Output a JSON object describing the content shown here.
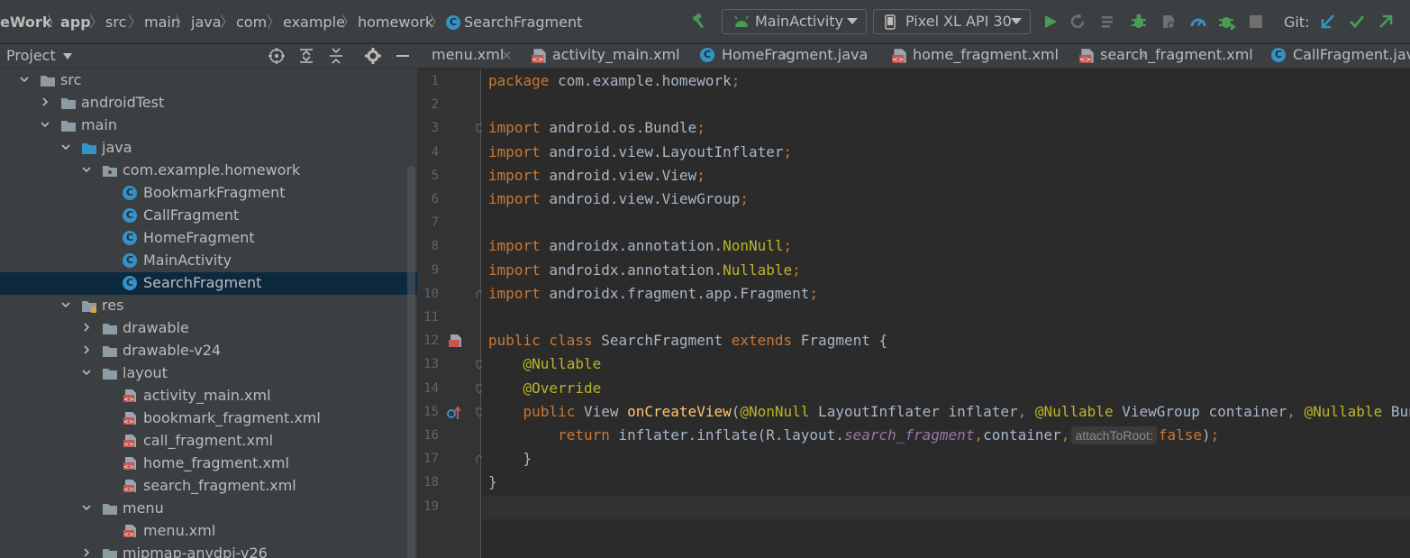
{
  "breadcrumb": [
    "eWork",
    "app",
    "src",
    "main",
    "java",
    "com",
    "example",
    "homework",
    "SearchFragment"
  ],
  "toolbar": {
    "run_config": "MainActivity",
    "device": "Pixel XL API 30",
    "git_label": "Git:"
  },
  "project_panel": {
    "title": "Project",
    "tree": [
      {
        "label": "src",
        "depth": 1,
        "kind": "folder",
        "expanded": true
      },
      {
        "label": "androidTest",
        "depth": 2,
        "kind": "folder",
        "expanded": false
      },
      {
        "label": "main",
        "depth": 2,
        "kind": "folder",
        "expanded": true
      },
      {
        "label": "java",
        "depth": 3,
        "kind": "src-folder",
        "expanded": true
      },
      {
        "label": "com.example.homework",
        "depth": 4,
        "kind": "package",
        "expanded": true
      },
      {
        "label": "BookmarkFragment",
        "depth": 5,
        "kind": "class"
      },
      {
        "label": "CallFragment",
        "depth": 5,
        "kind": "class"
      },
      {
        "label": "HomeFragment",
        "depth": 5,
        "kind": "class"
      },
      {
        "label": "MainActivity",
        "depth": 5,
        "kind": "class"
      },
      {
        "label": "SearchFragment",
        "depth": 5,
        "kind": "class",
        "selected": true
      },
      {
        "label": "res",
        "depth": 3,
        "kind": "res-folder",
        "expanded": true
      },
      {
        "label": "drawable",
        "depth": 4,
        "kind": "folder",
        "expanded": false
      },
      {
        "label": "drawable-v24",
        "depth": 4,
        "kind": "folder",
        "expanded": false
      },
      {
        "label": "layout",
        "depth": 4,
        "kind": "folder",
        "expanded": true
      },
      {
        "label": "activity_main.xml",
        "depth": 5,
        "kind": "xml"
      },
      {
        "label": "bookmark_fragment.xml",
        "depth": 5,
        "kind": "xml"
      },
      {
        "label": "call_fragment.xml",
        "depth": 5,
        "kind": "xml"
      },
      {
        "label": "home_fragment.xml",
        "depth": 5,
        "kind": "xml"
      },
      {
        "label": "search_fragment.xml",
        "depth": 5,
        "kind": "xml"
      },
      {
        "label": "menu",
        "depth": 4,
        "kind": "folder",
        "expanded": true
      },
      {
        "label": "menu.xml",
        "depth": 5,
        "kind": "xml"
      },
      {
        "label": "mipmap-anydpi-v26",
        "depth": 4,
        "kind": "folder",
        "expanded": false
      }
    ]
  },
  "tabs": [
    {
      "label": "menu.xml",
      "kind": "xml"
    },
    {
      "label": "activity_main.xml",
      "kind": "xml"
    },
    {
      "label": "HomeFragment.java",
      "kind": "class"
    },
    {
      "label": "home_fragment.xml",
      "kind": "xml"
    },
    {
      "label": "search_fragment.xml",
      "kind": "xml"
    },
    {
      "label": "CallFragment.java",
      "kind": "class"
    }
  ],
  "editor": {
    "line_numbers": [
      "1",
      "2",
      "3",
      "4",
      "5",
      "6",
      "7",
      "8",
      "9",
      "10",
      "11",
      "12",
      "13",
      "14",
      "15",
      "16",
      "17",
      "18",
      "19"
    ],
    "lines": [
      [
        [
          "kw",
          "package"
        ],
        [
          "p",
          " com.example.homework"
        ],
        [
          "kw",
          ";"
        ]
      ],
      [],
      [
        [
          "kw",
          "import"
        ],
        [
          "p",
          " android.os.Bundle"
        ],
        [
          "kw",
          ";"
        ]
      ],
      [
        [
          "kw",
          "import"
        ],
        [
          "p",
          " android.view.LayoutInflater"
        ],
        [
          "kw",
          ";"
        ]
      ],
      [
        [
          "kw",
          "import"
        ],
        [
          "p",
          " android.view.View"
        ],
        [
          "kw",
          ";"
        ]
      ],
      [
        [
          "kw",
          "import"
        ],
        [
          "p",
          " android.view.ViewGroup"
        ],
        [
          "kw",
          ";"
        ]
      ],
      [],
      [
        [
          "kw",
          "import"
        ],
        [
          "p",
          " androidx.annotation."
        ],
        [
          "ann",
          "NonNull"
        ],
        [
          "kw",
          ";"
        ]
      ],
      [
        [
          "kw",
          "import"
        ],
        [
          "p",
          " androidx.annotation."
        ],
        [
          "ann",
          "Nullable"
        ],
        [
          "kw",
          ";"
        ]
      ],
      [
        [
          "kw",
          "import"
        ],
        [
          "p",
          " androidx.fragment.app.Fragment"
        ],
        [
          "kw",
          ";"
        ]
      ],
      [],
      [
        [
          "kw",
          "public class"
        ],
        [
          "p",
          " SearchFragment "
        ],
        [
          "kw",
          "extends"
        ],
        [
          "p",
          " Fragment {"
        ]
      ],
      [
        [
          "p",
          "    "
        ],
        [
          "ann",
          "@Nullable"
        ]
      ],
      [
        [
          "p",
          "    "
        ],
        [
          "ann",
          "@Override"
        ]
      ],
      [
        [
          "p",
          "    "
        ],
        [
          "kw",
          "public"
        ],
        [
          "p",
          " View "
        ],
        [
          "fn",
          "onCreateView"
        ],
        [
          "p",
          "("
        ],
        [
          "ann",
          "@NonNull"
        ],
        [
          "p",
          " LayoutInflater inflater"
        ],
        [
          "kw",
          ", "
        ],
        [
          "ann",
          "@Nullable"
        ],
        [
          "p",
          " ViewGroup container"
        ],
        [
          "kw",
          ", "
        ],
        [
          "ann",
          "@Nullable"
        ],
        [
          "p",
          " Bundle savedInstanceState) {"
        ]
      ],
      [
        [
          "p",
          "        "
        ],
        [
          "kw",
          "return"
        ],
        [
          "p",
          " inflater.inflate(R.layout."
        ],
        [
          "fld",
          "search_fragment"
        ],
        [
          "kw",
          ","
        ],
        [
          "p",
          "container"
        ],
        [
          "kw",
          ","
        ],
        [
          "hint",
          "attachToRoot:"
        ],
        [
          "kw",
          "false"
        ],
        [
          "p",
          ")"
        ],
        [
          "kw",
          ";"
        ]
      ],
      [
        [
          "p",
          "    }"
        ]
      ],
      [
        [
          "p",
          "}"
        ]
      ],
      []
    ]
  },
  "colors": {
    "keyword": "#cc7832",
    "annotation": "#bbb529",
    "method": "#ffc66d",
    "field": "#9876aa",
    "plain": "#a9b7c6",
    "class_icon": "#3592c4",
    "run_green": "#499c54"
  }
}
